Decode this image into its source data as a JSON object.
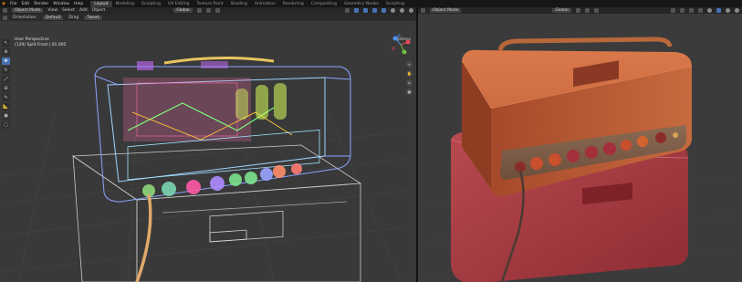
{
  "top_menu": [
    "File",
    "Edit",
    "Render",
    "Window",
    "Help"
  ],
  "workspace_tabs": [
    "Layout",
    "Modeling",
    "Sculpting",
    "UV Editing",
    "Texture Paint",
    "Shading",
    "Animation",
    "Rendering",
    "Compositing",
    "Geometry Nodes",
    "Scripting"
  ],
  "active_tab": "Layout",
  "left_viewport": {
    "mode": "Object Mode",
    "menus": [
      "View",
      "Select",
      "Add",
      "Object"
    ],
    "orientation_label": "Orientation:",
    "orientation_value": "Default",
    "drag_label": "Drag",
    "drag_value": "Tweak",
    "transform_space": "Global",
    "options_label": "Options",
    "overlay_line1": "User Perspective",
    "overlay_line2": "(129) Split Front | 01.002",
    "shading": "wireframe"
  },
  "right_viewport": {
    "mode": "Object Mode",
    "transform_space": "Global",
    "shading": "solid"
  },
  "gizmo_axes": [
    "X",
    "Y",
    "Z"
  ],
  "colors": {
    "selected_blue": "#4772b3",
    "wire_blue": "#7f9cff",
    "amp_head": "#b85a33",
    "amp_cab": "#a33a3e"
  }
}
